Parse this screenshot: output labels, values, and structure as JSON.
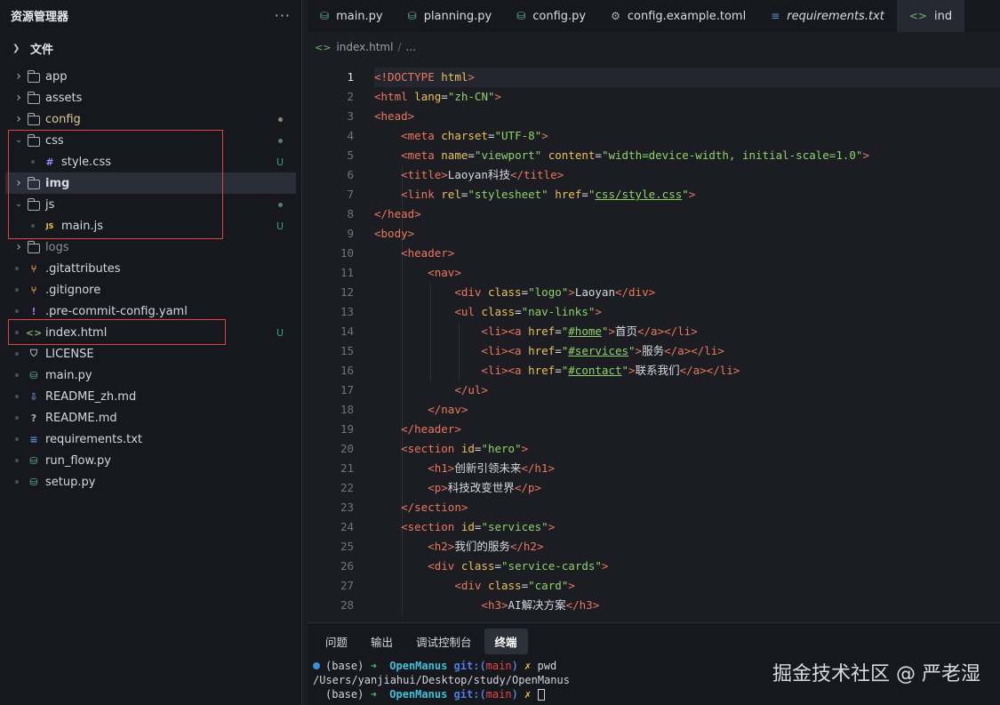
{
  "sidebar": {
    "title": "资源管理器",
    "more_icon": "more-icon",
    "section_label": "文件",
    "items": [
      {
        "label": "app",
        "type": "folder",
        "expanded": false,
        "status": ""
      },
      {
        "label": "assets",
        "type": "folder",
        "expanded": false,
        "status": ""
      },
      {
        "label": "config",
        "type": "folder",
        "expanded": false,
        "status": "dot"
      },
      {
        "label": "css",
        "type": "folder",
        "expanded": true,
        "status": "dot"
      },
      {
        "label": "style.css",
        "type": "css",
        "status": "U"
      },
      {
        "label": "img",
        "type": "folder",
        "expanded": false,
        "status": ""
      },
      {
        "label": "js",
        "type": "folder",
        "expanded": true,
        "status": "dot"
      },
      {
        "label": "main.js",
        "type": "js",
        "status": "U"
      },
      {
        "label": "logs",
        "type": "folder",
        "expanded": false,
        "status": ""
      },
      {
        "label": ".gitattributes",
        "type": "git",
        "status": ""
      },
      {
        "label": ".gitignore",
        "type": "git",
        "status": ""
      },
      {
        "label": ".pre-commit-config.yaml",
        "type": "yaml",
        "status": ""
      },
      {
        "label": "index.html",
        "type": "html",
        "status": "U"
      },
      {
        "label": "LICENSE",
        "type": "license",
        "status": ""
      },
      {
        "label": "main.py",
        "type": "py",
        "status": ""
      },
      {
        "label": "README_zh.md",
        "type": "md-down",
        "status": ""
      },
      {
        "label": "README.md",
        "type": "md",
        "status": ""
      },
      {
        "label": "requirements.txt",
        "type": "txt",
        "status": ""
      },
      {
        "label": "run_flow.py",
        "type": "py",
        "status": ""
      },
      {
        "label": "setup.py",
        "type": "py",
        "status": ""
      }
    ]
  },
  "tabs": [
    {
      "label": "main.py",
      "icon": "python-icon"
    },
    {
      "label": "planning.py",
      "icon": "python-icon"
    },
    {
      "label": "config.py",
      "icon": "python-icon"
    },
    {
      "label": "config.example.toml",
      "icon": "gear-icon"
    },
    {
      "label": "requirements.txt",
      "icon": "list-icon"
    },
    {
      "label": "ind",
      "icon": "html-icon"
    }
  ],
  "breadcrumb": {
    "file": "index.html",
    "sep": "/",
    "rest": "..."
  },
  "editor": {
    "line_numbers": [
      "1",
      "2",
      "3",
      "4",
      "5",
      "6",
      "7",
      "8",
      "9",
      "10",
      "11",
      "12",
      "13",
      "14",
      "15",
      "16",
      "17",
      "18",
      "19",
      "20",
      "21",
      "22",
      "23",
      "24",
      "25",
      "26",
      "27",
      "28"
    ],
    "current_line": "1"
  },
  "panel": {
    "tabs": [
      "问题",
      "输出",
      "调试控制台",
      "终端"
    ],
    "active_tab": "终端",
    "terminal": {
      "env": "(base)",
      "arrow": "➜",
      "dir": "OpenManus",
      "git": "git:(",
      "branch": "main",
      "git_close": ")",
      "dirty": "✗",
      "cmd": "pwd",
      "output": "/Users/yanjiahui/Desktop/study/OpenManus"
    }
  },
  "watermark": "掘金技术社区 @ 严老湿",
  "colors": {
    "tag": "#e9775e",
    "attr": "#e8c15a",
    "string": "#8fd26a",
    "highlight_box": "#e0443e",
    "untracked": "#3aa37a"
  }
}
